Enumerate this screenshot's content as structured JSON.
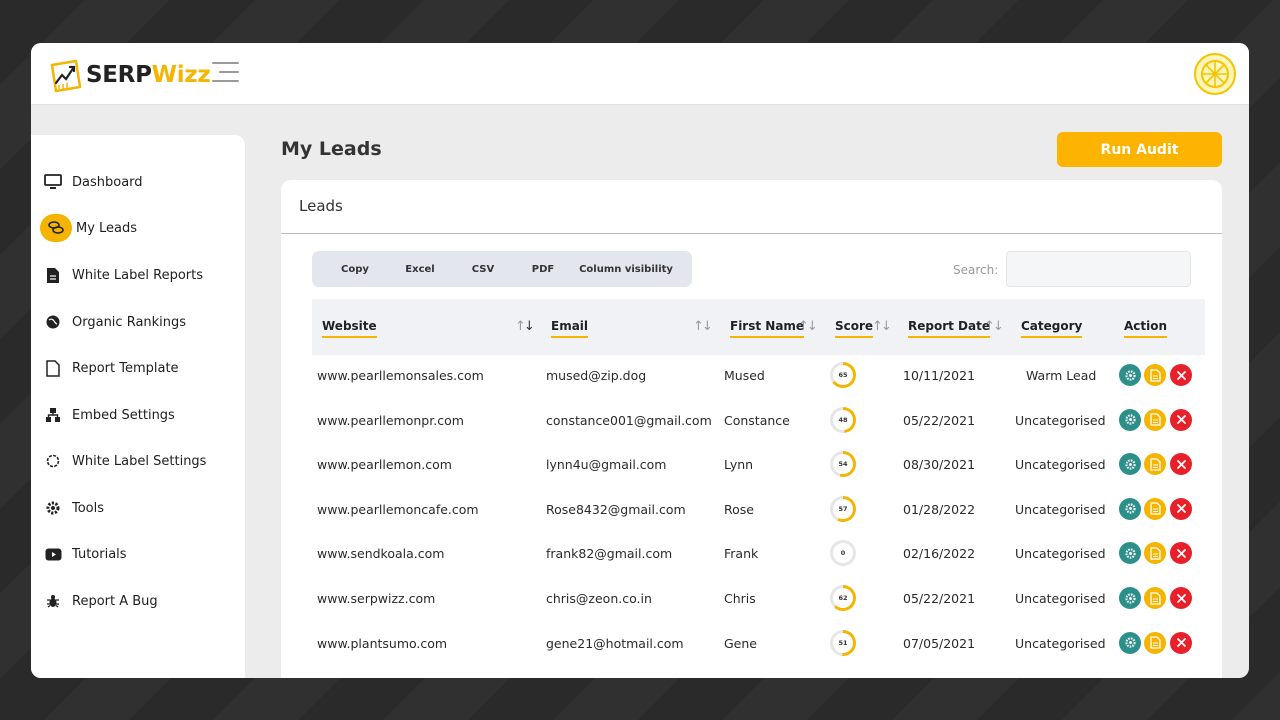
{
  "brand": {
    "part1": "SERP",
    "part2": "Wizz"
  },
  "sidebar": {
    "items": [
      {
        "label": "Dashboard",
        "icon": "monitor-icon"
      },
      {
        "label": "My Leads",
        "icon": "coins-icon"
      },
      {
        "label": "White Label Reports",
        "icon": "file-icon"
      },
      {
        "label": "Organic Rankings",
        "icon": "globe-icon"
      },
      {
        "label": "Report Template",
        "icon": "document-icon"
      },
      {
        "label": "Embed Settings",
        "icon": "sitemap-icon"
      },
      {
        "label": "White Label Settings",
        "icon": "settings-outline-icon"
      },
      {
        "label": "Tools",
        "icon": "gear-icon"
      },
      {
        "label": "Tutorials",
        "icon": "video-icon"
      },
      {
        "label": "Report A Bug",
        "icon": "bug-icon"
      }
    ]
  },
  "page": {
    "title": "My Leads",
    "run_audit": "Run Audit"
  },
  "card": {
    "title": "Leads"
  },
  "toolbar": {
    "copy": "Copy",
    "excel": "Excel",
    "csv": "CSV",
    "pdf": "PDF",
    "colvis": "Column visibility"
  },
  "search": {
    "label": "Search:",
    "value": ""
  },
  "table": {
    "headers": {
      "website": "Website",
      "email": "Email",
      "first_name": "First Name",
      "score": "Score",
      "report_date": "Report Date",
      "category": "Category",
      "action": "Action"
    },
    "rows": [
      {
        "website": "www.pearllemonsales.com",
        "email": "mused@zip.dog",
        "first_name": "Mused",
        "score": "65",
        "date": "10/11/2021",
        "category": "Warm Lead"
      },
      {
        "website": "www.pearllemonpr.com",
        "email": "constance001@gmail.com",
        "first_name": "Constance",
        "score": "48",
        "date": "05/22/2021",
        "category": "Uncategorised"
      },
      {
        "website": "www.pearllemon.com",
        "email": "lynn4u@gmail.com",
        "first_name": "Lynn",
        "score": "54",
        "date": "08/30/2021",
        "category": "Uncategorised"
      },
      {
        "website": "www.pearllemoncafe.com",
        "email": "Rose8432@gmail.com",
        "first_name": "Rose",
        "score": "57",
        "date": "01/28/2022",
        "category": "Uncategorised"
      },
      {
        "website": "www.sendkoala.com",
        "email": "frank82@gmail.com",
        "first_name": "Frank",
        "score": "0",
        "date": "02/16/2022",
        "category": "Uncategorised"
      },
      {
        "website": "www.serpwizz.com",
        "email": "chris@zeon.co.in",
        "first_name": "Chris",
        "score": "62",
        "date": "05/22/2021",
        "category": "Uncategorised"
      },
      {
        "website": "www.plantsumo.com",
        "email": "gene21@hotmail.com",
        "first_name": "Gene",
        "score": "51",
        "date": "07/05/2021",
        "category": "Uncategorised"
      }
    ]
  },
  "colors": {
    "accent": "#f5b400",
    "teal": "#2d8f8a",
    "danger": "#e8202a"
  }
}
